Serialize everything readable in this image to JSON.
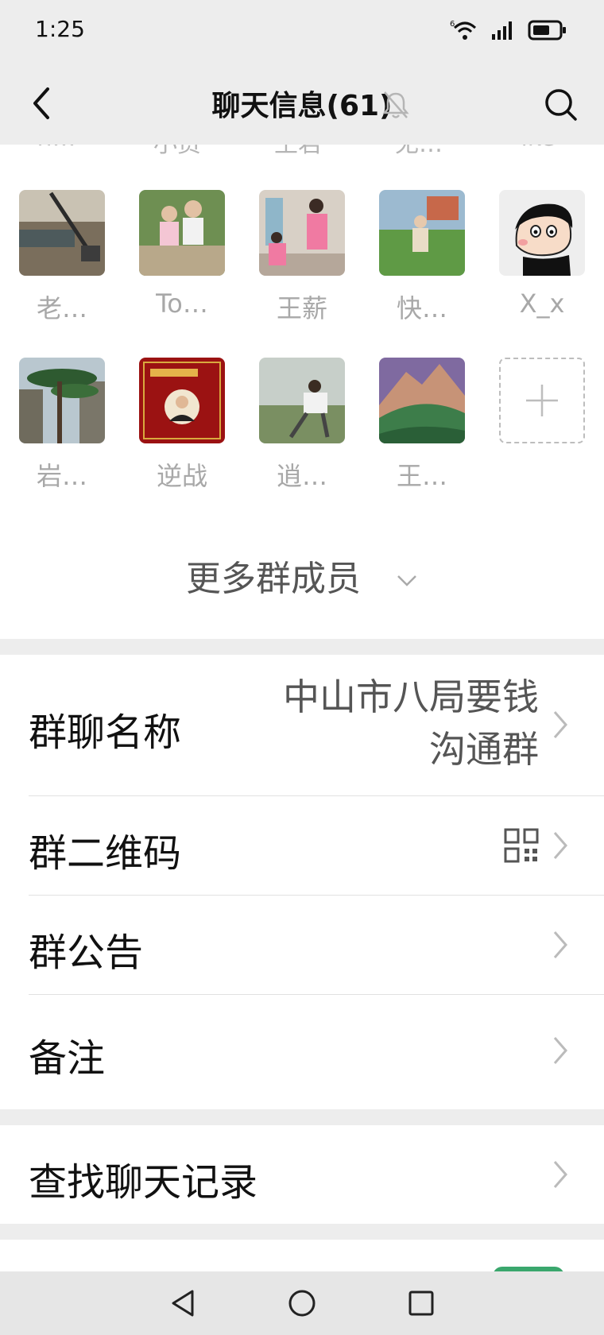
{
  "status_bar": {
    "time": "1:25",
    "signal_prefix": "6"
  },
  "header": {
    "title": "聊天信息(61)"
  },
  "members": {
    "partial_row_names": [
      "n…",
      "小资",
      "王君",
      "无…",
      "ike"
    ],
    "rows": [
      [
        {
          "name": "老…",
          "avatar": "construction-photo"
        },
        {
          "name": "To…",
          "avatar": "kids-photo"
        },
        {
          "name": "王薪",
          "avatar": "playground-photo"
        },
        {
          "name": "快…",
          "avatar": "toddler-photo"
        },
        {
          "name": "X_x",
          "avatar": "cartoon-avatar"
        }
      ],
      [
        {
          "name": "岩…",
          "avatar": "pine-tree-photo"
        },
        {
          "name": "逆战",
          "avatar": "red-poster-avatar"
        },
        {
          "name": "逍…",
          "avatar": "mountain-man-photo"
        },
        {
          "name": "王…",
          "avatar": "green-mountain-photo"
        }
      ]
    ],
    "add_member_icon": "plus-icon",
    "more_label": "更多群成员"
  },
  "group1": {
    "name_label": "群聊名称",
    "name_value_line1": "中山市八局要钱",
    "name_value_line2": "沟通群",
    "qr_label": "群二维码",
    "announcement_label": "群公告",
    "remark_label": "备注"
  },
  "group2": {
    "search_history_label": "查找聊天记录"
  },
  "colors": {
    "background": "#ededed",
    "panel": "#ffffff",
    "accent": "#3aa76d"
  }
}
